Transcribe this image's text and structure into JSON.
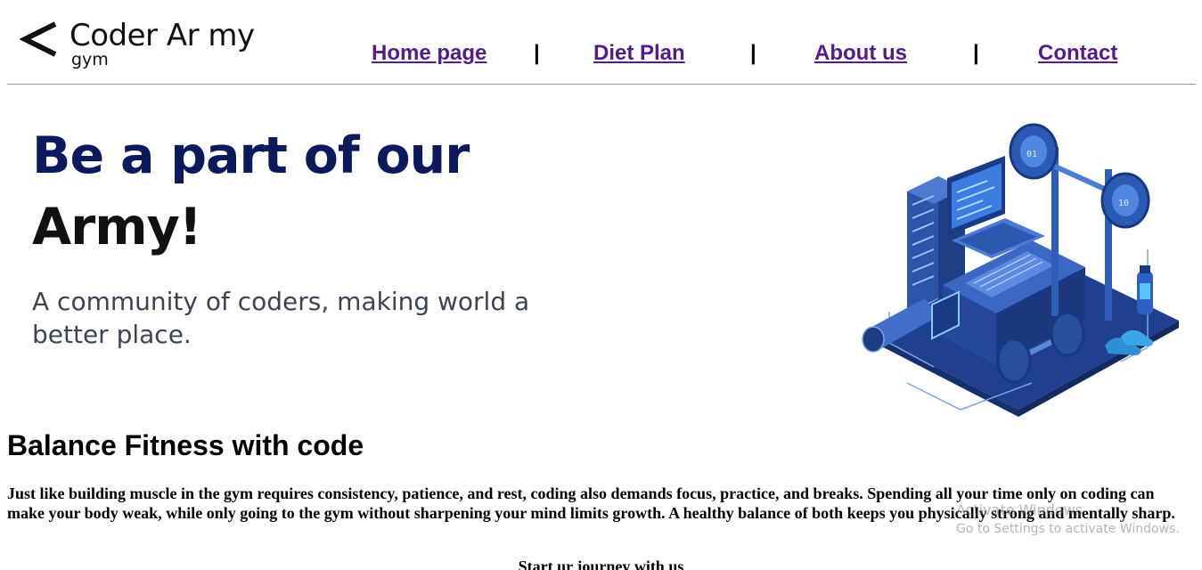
{
  "header": {
    "logo_title": "Coder Ar my",
    "logo_sub": "gym",
    "nav": [
      {
        "label": "Home page"
      },
      {
        "label": "Diet Plan"
      },
      {
        "label": "About us"
      },
      {
        "label": "Contact"
      }
    ],
    "separator": "|"
  },
  "hero": {
    "headline_1": "Be a part of our",
    "headline_2": "Army!",
    "description": "A community of coders, making world a better place."
  },
  "section": {
    "title": "Balance Fitness with code",
    "body": "Just like building muscle in the gym requires consistency, patience, and rest, coding also demands focus, practice, and breaks. Spending all your time only on coding can make your body weak, while only going to the gym without sharpening your mind limits growth. A healthy balance of both keeps you physically strong and mentally sharp."
  },
  "cta": "Start ur journey with us",
  "watermark": {
    "line1": "Activate Windows",
    "line2": "Go to Settings to activate Windows."
  },
  "colors": {
    "link": "#551a8b",
    "hero_navy": "#0b1a5c",
    "illustration_blue": "#2f5fb3"
  }
}
